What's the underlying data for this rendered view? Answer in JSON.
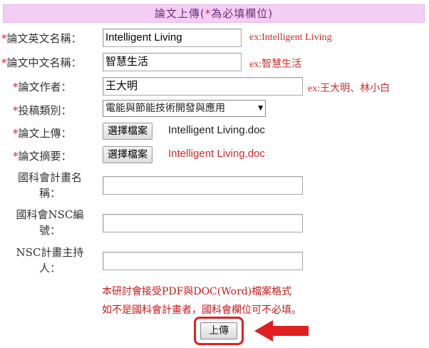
{
  "header": {
    "title_prefix": "論文上傳(",
    "star": "*",
    "title_suffix": "為必填欄位)"
  },
  "fields": {
    "en_title": {
      "label": "論文英文名稱：",
      "value": "Intelligent Living",
      "hint": "ex:Intelligent Living"
    },
    "zh_title": {
      "label": "論文中文名稱：",
      "value": "智慧生活",
      "hint": "ex:智慧生活"
    },
    "author": {
      "label": "論文作者：",
      "value": "王大明",
      "hint": "ex:王大明、林小白"
    },
    "category": {
      "label": "投稿類別：",
      "selected": "電能與節能技術開發與應用"
    },
    "paper_upload": {
      "label": "論文上傳：",
      "button": "選擇檔案",
      "filename": "Intelligent Living.doc"
    },
    "abstract_upload": {
      "label": "論文摘要：",
      "button": "選擇檔案",
      "filename": "Intelligent Living.doc"
    },
    "nsc_plan_name": {
      "label_line1": "國科會計畫名",
      "label_line2": "稱：",
      "value": ""
    },
    "nsc_number": {
      "label_line1": "國科會NSC編",
      "label_line2": "號：",
      "value": ""
    },
    "nsc_pi": {
      "label_line1": "NSC計畫主持",
      "label_line2": "人：",
      "value": ""
    }
  },
  "notes": {
    "line1": "本研討會接受PDF與DOC(Word)檔案格式",
    "line2": "如不是國科會計畫者，國科會欄位可不必填。"
  },
  "submit": {
    "label": "上傳"
  },
  "colors": {
    "required": "#e0203a",
    "hint": "#d02a2a",
    "header_bg": "#f4cdf4",
    "highlight": "#e02020"
  }
}
